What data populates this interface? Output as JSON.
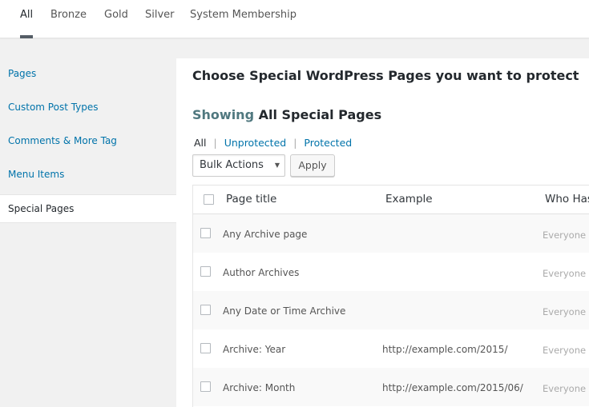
{
  "top_tabs": [
    {
      "label": "All",
      "active": true
    },
    {
      "label": "Bronze",
      "active": false
    },
    {
      "label": "Gold",
      "active": false
    },
    {
      "label": "Silver",
      "active": false
    },
    {
      "label": "System Membership",
      "active": false
    }
  ],
  "sidebar": {
    "items": [
      {
        "label": "Pages"
      },
      {
        "label": "Custom Post Types"
      },
      {
        "label": "Comments & More Tag"
      },
      {
        "label": "Menu Items"
      },
      {
        "label": "Special Pages"
      }
    ]
  },
  "main": {
    "title": "Choose Special WordPress Pages you want to protect",
    "showing_lead": "Showing",
    "showing_rest": "All Special Pages",
    "filters": {
      "all": "All",
      "unprotected": "Unprotected",
      "protected": "Protected",
      "separator": "|"
    },
    "bulk_actions": "Bulk Actions",
    "apply": "Apply",
    "table": {
      "columns": {
        "title": "Page title",
        "example": "Example",
        "who": "Who Has"
      },
      "rows": [
        {
          "title": "Any Archive page",
          "example": "",
          "who": "Everyone"
        },
        {
          "title": "Author Archives",
          "example": "",
          "who": "Everyone"
        },
        {
          "title": "Any Date or Time Archive",
          "example": "",
          "who": "Everyone"
        },
        {
          "title": "Archive: Year",
          "example": "http://example.com/2015/",
          "who": "Everyone"
        },
        {
          "title": "Archive: Month",
          "example": "http://example.com/2015/06/",
          "who": "Everyone"
        }
      ]
    }
  },
  "colors": {
    "link": "#0073aa",
    "text": "#23282d",
    "accent_showing": "#50787f",
    "tab_indicator": "#555d66"
  },
  "icons": {
    "dropdown": "chevron-down-icon",
    "checkbox": "checkbox-icon"
  }
}
